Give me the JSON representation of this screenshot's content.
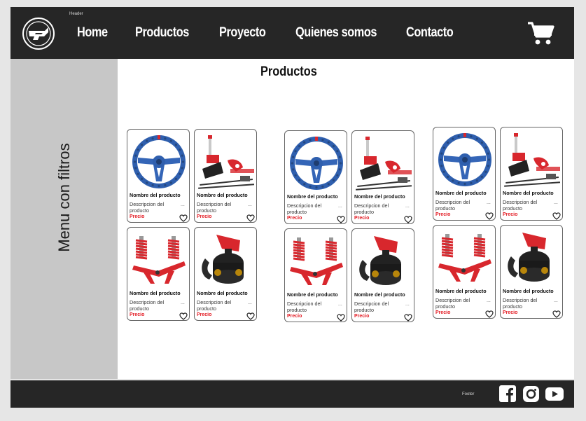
{
  "header": {
    "caption": "Header",
    "nav": [
      "Home",
      "Productos",
      "Proyecto",
      "Quienes somos",
      "Contacto"
    ],
    "cart_icon": "shopping-cart-icon"
  },
  "sidebar": {
    "label": "Menu con filtros"
  },
  "main": {
    "title": "Productos"
  },
  "product_labels": {
    "name": "Nombre del producto",
    "description": "Descripcion del producto",
    "price": "Precio",
    "more": "..."
  },
  "products": [
    {
      "image": "steering-wheel"
    },
    {
      "image": "hydraulic-handbrake"
    },
    {
      "image": "coilover-suspension"
    },
    {
      "image": "battery-kill-switch"
    }
  ],
  "footer": {
    "caption": "Footer",
    "social_icons": [
      "facebook-icon",
      "instagram-icon",
      "youtube-icon"
    ]
  },
  "colors": {
    "dark": "#262626",
    "sidebar": "#c7c7c7",
    "price": "#e31b23",
    "product_blue": "#2f5fae",
    "product_red": "#d8272d"
  }
}
